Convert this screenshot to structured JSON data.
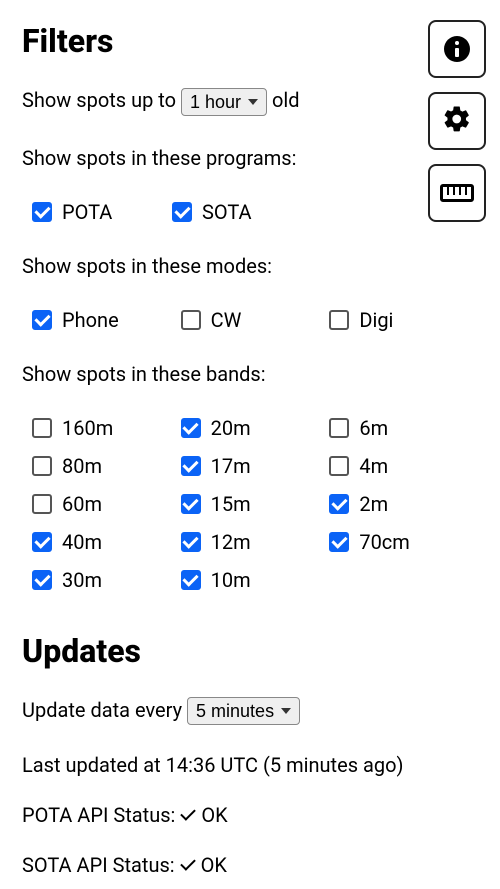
{
  "filters": {
    "heading": "Filters",
    "age_prefix": "Show spots up to ",
    "age_selected": "1 hour",
    "age_suffix": " old",
    "programs_label": "Show spots in these programs:",
    "programs": [
      {
        "name": "POTA",
        "checked": true
      },
      {
        "name": "SOTA",
        "checked": true
      }
    ],
    "modes_label": "Show spots in these modes:",
    "modes": [
      {
        "name": "Phone",
        "checked": true
      },
      {
        "name": "CW",
        "checked": false
      },
      {
        "name": "Digi",
        "checked": false
      }
    ],
    "bands_label": "Show spots in these bands:",
    "bands": [
      {
        "name": "160m",
        "checked": false
      },
      {
        "name": "20m",
        "checked": true
      },
      {
        "name": "6m",
        "checked": false
      },
      {
        "name": "80m",
        "checked": false
      },
      {
        "name": "17m",
        "checked": true
      },
      {
        "name": "4m",
        "checked": false
      },
      {
        "name": "60m",
        "checked": false
      },
      {
        "name": "15m",
        "checked": true
      },
      {
        "name": "2m",
        "checked": true
      },
      {
        "name": "40m",
        "checked": true
      },
      {
        "name": "12m",
        "checked": true
      },
      {
        "name": "70cm",
        "checked": true
      },
      {
        "name": "30m",
        "checked": true
      },
      {
        "name": "10m",
        "checked": true
      }
    ]
  },
  "updates": {
    "heading": "Updates",
    "interval_prefix": "Update data every ",
    "interval_selected": "5 minutes",
    "last_updated": "Last updated at 14:36 UTC (5 minutes ago)",
    "pota_status_label": "POTA API Status: ",
    "pota_status_value": "OK",
    "sota_status_label": "SOTA API Status: ",
    "sota_status_value": "OK"
  },
  "toolbar": {
    "info": "info-button",
    "settings": "settings-button",
    "ruler": "ruler-button"
  }
}
